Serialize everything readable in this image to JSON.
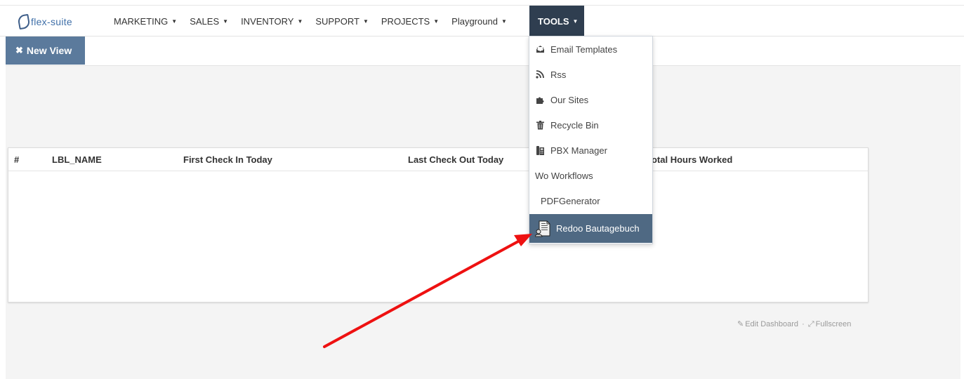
{
  "brand": {
    "logo_text": "flex-suite"
  },
  "nav": {
    "items": [
      {
        "label": "MARKETING"
      },
      {
        "label": "SALES"
      },
      {
        "label": "INVENTORY"
      },
      {
        "label": "SUPPORT"
      },
      {
        "label": "PROJECTS"
      },
      {
        "label": "Playground"
      }
    ],
    "active": {
      "label": "TOOLS"
    }
  },
  "toolbar": {
    "new_view_label": "New View",
    "new_view_icon": "close-icon"
  },
  "table": {
    "columns": [
      "#",
      "LBL_NAME",
      "First Check In Today",
      "Last Check Out Today",
      "Total Hours Worked"
    ]
  },
  "dashboard_links": {
    "edit": "Edit Dashboard",
    "separator": "·",
    "fullscreen": "Fullscreen"
  },
  "tools_menu": {
    "items": [
      {
        "label": "Email Templates",
        "icon": "email-template-icon"
      },
      {
        "label": "Rss",
        "icon": "rss-icon"
      },
      {
        "label": "Our Sites",
        "icon": "puzzle-icon"
      },
      {
        "label": "Recycle Bin",
        "icon": "trash-icon"
      },
      {
        "label": "PBX Manager",
        "icon": "phone-icon"
      },
      {
        "label": "Wo Workflows",
        "icon": ""
      },
      {
        "label": "PDFGenerator",
        "icon": ""
      },
      {
        "label": "Redoo Bautagebuch",
        "icon": "document-person-icon",
        "highlighted": true
      }
    ]
  },
  "colors": {
    "nav_active_bg": "#2f3e50",
    "new_view_bg": "#5b7a9c",
    "menu_highlight_bg": "#4f6983",
    "annotation_arrow": "#ee1111"
  }
}
